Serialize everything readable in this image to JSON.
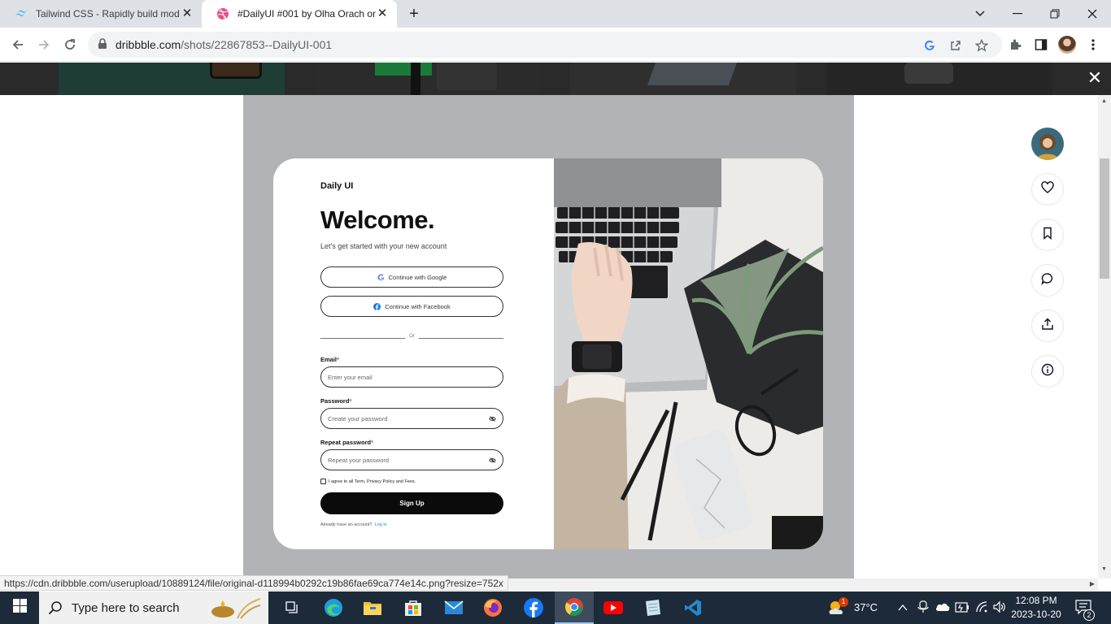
{
  "browser": {
    "tabs": [
      {
        "title": "Tailwind CSS - Rapidly build mod",
        "active": false
      },
      {
        "title": "#DailyUI #001 by Olha Orach on",
        "active": true
      }
    ],
    "url_domain": "dribbble.com",
    "url_path": "/shots/22867853--DailyUI-001",
    "status_url": "https://cdn.dribbble.com/userupload/10889124/file/original-d118994b0292c19b86fae69ca774e14c.png?resize=752x"
  },
  "shot": {
    "brand": "Daily UI",
    "heading": "Welcome.",
    "subtitle": "Let's get started with your new account",
    "google_button": "Continue with Google",
    "facebook_button": "Continue with Facebook",
    "divider_text": "Or",
    "email_label": "Email",
    "email_placeholder": "Enter your email",
    "password_label": "Password",
    "password_placeholder": "Create your password",
    "repeat_label": "Repeat password",
    "repeat_placeholder": "Repeat your password",
    "required_mark": "*",
    "agree_text": "I agree to all Term, Privacy Policy and Fees.",
    "signup_button": "Sign Up",
    "account_prompt": "Already have an account?",
    "login_link": "Log in"
  },
  "taskbar": {
    "search_placeholder": "Type here to search",
    "temperature": "37°C",
    "weather_badge": "1",
    "time": "12:08 PM",
    "date": "2023-10-20",
    "notification_count": "2"
  },
  "colors": {
    "accent_link": "#1e88e5",
    "required": "#e53935",
    "shot_background": "#b2b3b6"
  }
}
